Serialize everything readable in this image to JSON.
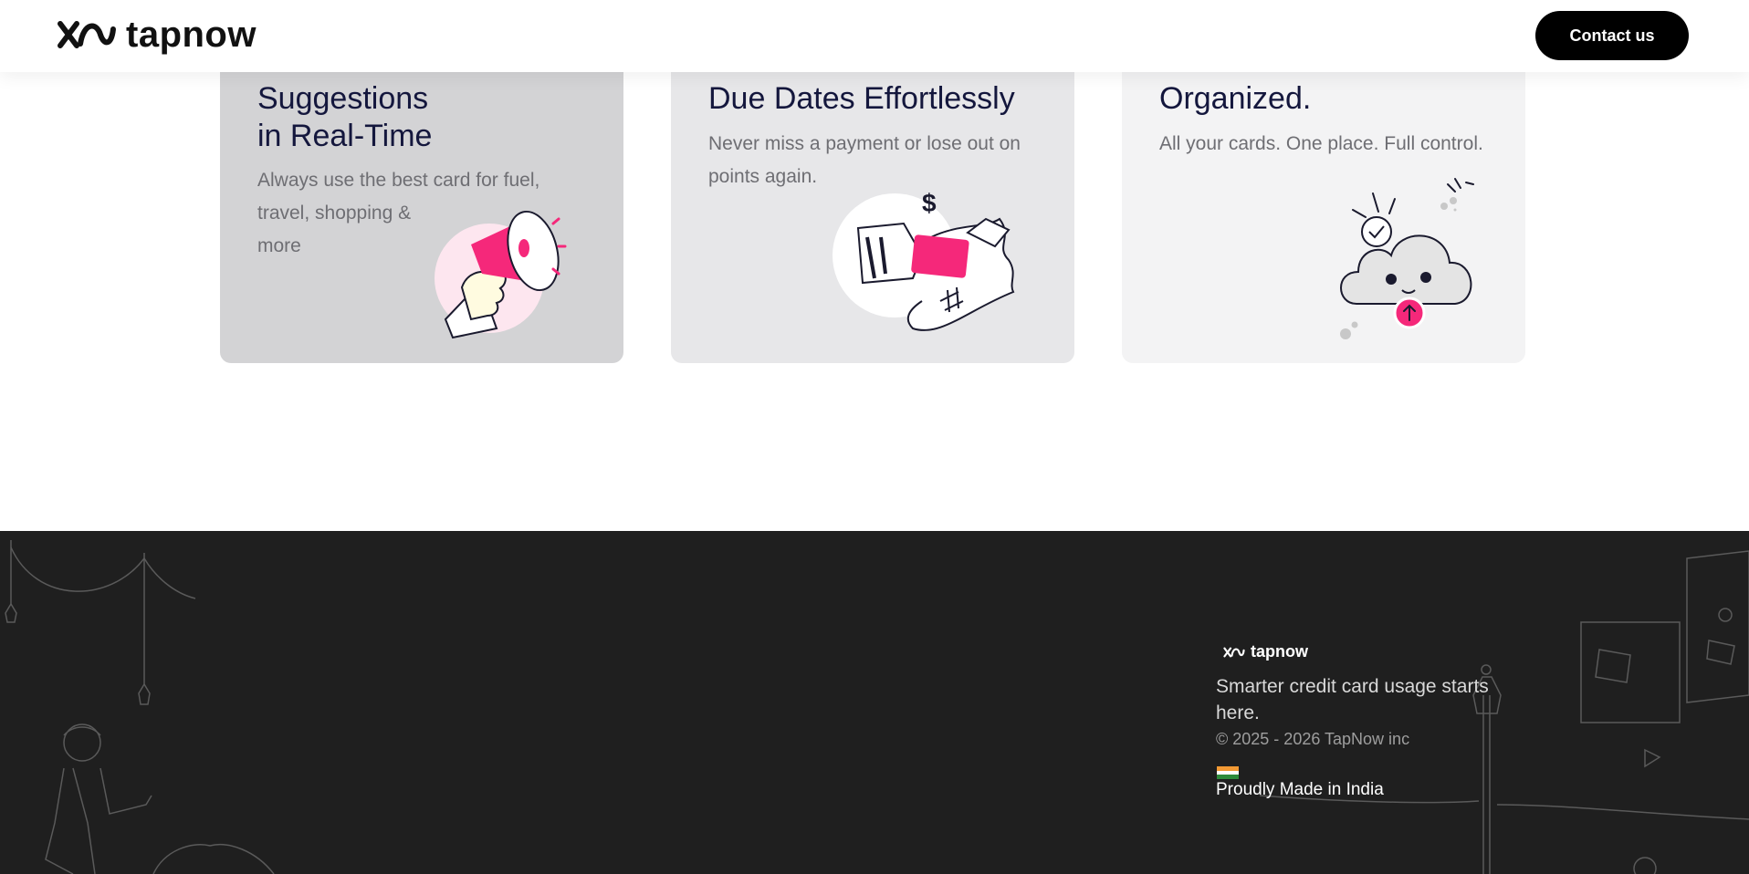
{
  "header": {
    "brand_name": "tapnow",
    "contact_label": "Contact us"
  },
  "cards": [
    {
      "title": "Suggestions\nin Real-Time",
      "description": "Always use the best card for fuel,\ntravel, shopping &\nmore",
      "illustration": "megaphone-icon"
    },
    {
      "title": "Due Dates Effortlessly",
      "description": "Never miss a payment or lose out on\npoints again.",
      "illustration": "card-payment-icon"
    },
    {
      "title": "Organized.",
      "description": "All your cards. One place. Full control.",
      "illustration": "cloud-upload-icon"
    }
  ],
  "footer": {
    "brand_name": "tapnow",
    "tagline": "Smarter credit card usage starts here.",
    "copyright": "© 2025 - 2026 TapNow inc",
    "made_in": "Proudly Made in India"
  },
  "colors": {
    "accent": "#f5287a",
    "title": "#14173d",
    "footer_bg": "#1f1f1f"
  }
}
